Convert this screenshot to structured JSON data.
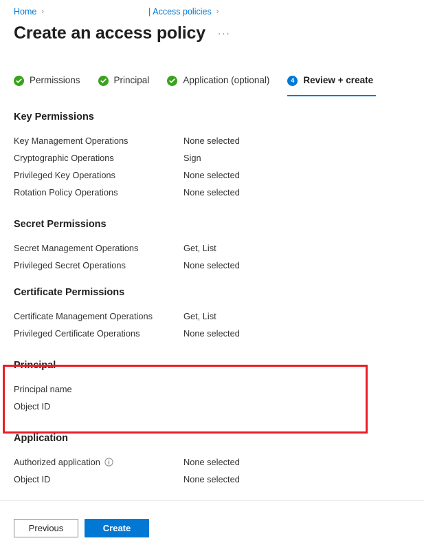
{
  "breadcrumb": {
    "home_label": "Home",
    "separator": "›",
    "pipe": "|",
    "current_label": "Access policies"
  },
  "header": {
    "title": "Create an access policy",
    "more_actions": "···"
  },
  "tabs": [
    {
      "label": "Permissions",
      "state": "complete",
      "badge": "check"
    },
    {
      "label": "Principal",
      "state": "complete",
      "badge": "check"
    },
    {
      "label": "Application (optional)",
      "state": "complete",
      "badge": "check"
    },
    {
      "label": "Review + create",
      "state": "active",
      "badge": "4"
    }
  ],
  "sections": [
    {
      "heading": "Key Permissions",
      "rows": [
        {
          "label": "Key Management Operations",
          "value": "None selected"
        },
        {
          "label": "Cryptographic Operations",
          "value": "Sign"
        },
        {
          "label": "Privileged Key Operations",
          "value": "None selected"
        },
        {
          "label": "Rotation Policy Operations",
          "value": "None selected"
        }
      ]
    },
    {
      "heading": "Secret Permissions",
      "rows": [
        {
          "label": "Secret Management Operations",
          "value": "Get, List"
        },
        {
          "label": "Privileged Secret Operations",
          "value": "None selected"
        }
      ]
    },
    {
      "heading": "Certificate Permissions",
      "rows": [
        {
          "label": "Certificate Management Operations",
          "value": "Get, List"
        },
        {
          "label": "Privileged Certificate Operations",
          "value": "None selected"
        }
      ]
    },
    {
      "heading": "Principal",
      "highlighted": true,
      "rows": [
        {
          "label": "Principal name",
          "value": ""
        },
        {
          "label": "Object ID",
          "value": ""
        }
      ]
    },
    {
      "heading": "Application",
      "rows": [
        {
          "label": "Authorized application",
          "value": "None selected",
          "info": true
        },
        {
          "label": "Object ID",
          "value": "None selected"
        }
      ]
    }
  ],
  "footer": {
    "previous_label": "Previous",
    "create_label": "Create"
  },
  "colors": {
    "accent": "#0078d4",
    "success": "#3aa21d",
    "highlight": "#ed1c24",
    "text": "#323130",
    "heading": "#201f1e"
  }
}
